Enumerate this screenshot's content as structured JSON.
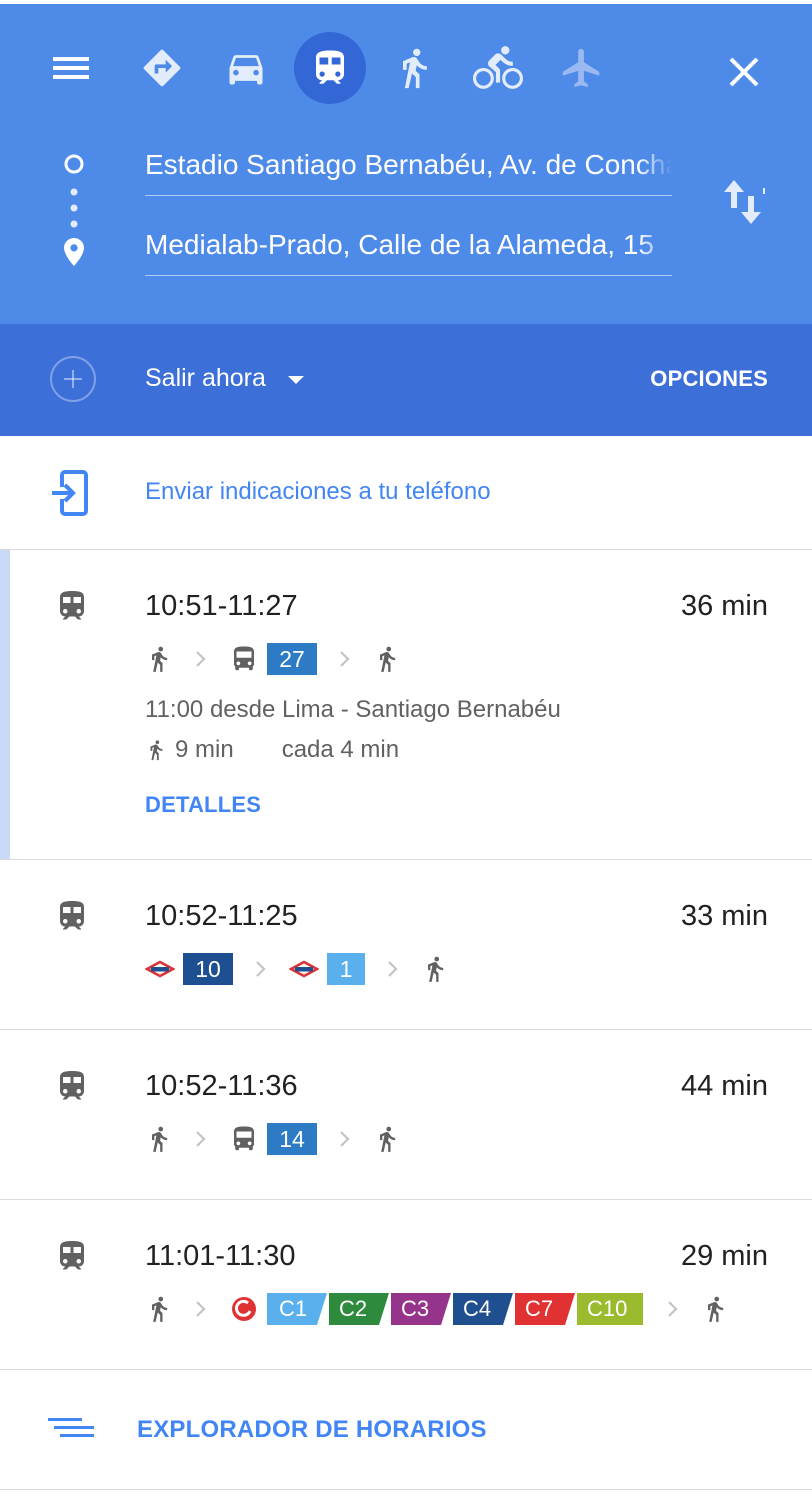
{
  "header": {
    "modes": [
      {
        "name": "best-route-icon",
        "active": false
      },
      {
        "name": "car-icon",
        "active": false
      },
      {
        "name": "transit-icon",
        "active": true
      },
      {
        "name": "walk-icon",
        "active": false
      },
      {
        "name": "bicycle-icon",
        "active": false
      },
      {
        "name": "flight-icon",
        "active": false
      }
    ],
    "origin": "Estadio Santiago Bernabéu, Av. de Concha Espina",
    "destination": "Medialab-Prado, Calle de la Alameda, 15",
    "depart_label": "Salir ahora",
    "options_label": "OPCIONES",
    "colors": {
      "primary": "#4e8ae8",
      "secondary": "#3d6fd9",
      "active_mode": "#3367d6"
    }
  },
  "send_to_phone": {
    "label": "Enviar indicaciones a tu teléfono"
  },
  "routes": [
    {
      "time": "10:51-11:27",
      "duration": "36 min",
      "bus_line": "27",
      "departure_info": "11:00 desde Lima - Santiago Bernabéu",
      "walk_time": "9 min",
      "frequency": "cada 4 min",
      "details_label": "DETALLES",
      "selected": true
    },
    {
      "time": "10:52-11:25",
      "duration": "33 min",
      "metro_lines": [
        {
          "label": "10",
          "color": "#1d4f91"
        },
        {
          "label": "1",
          "color": "#5ab0ec"
        }
      ]
    },
    {
      "time": "10:52-11:36",
      "duration": "44 min",
      "bus_line": "14"
    },
    {
      "time": "11:01-11:30",
      "duration": "29 min",
      "cercanias_lines": [
        {
          "label": "C1",
          "color": "#5ab0ec"
        },
        {
          "label": "C2",
          "color": "#2e8b3e"
        },
        {
          "label": "C3",
          "color": "#96338a"
        },
        {
          "label": "C4",
          "color": "#1f4f8f"
        },
        {
          "label": "C7",
          "color": "#e03232"
        },
        {
          "label": "C10",
          "color": "#9bbb2e"
        }
      ]
    }
  ],
  "explorer": {
    "label": "EXPLORADOR DE HORARIOS"
  },
  "colors": {
    "bus_badge": "#2d7bc4",
    "link": "#4285f4",
    "metro_logo": "#e03232"
  }
}
